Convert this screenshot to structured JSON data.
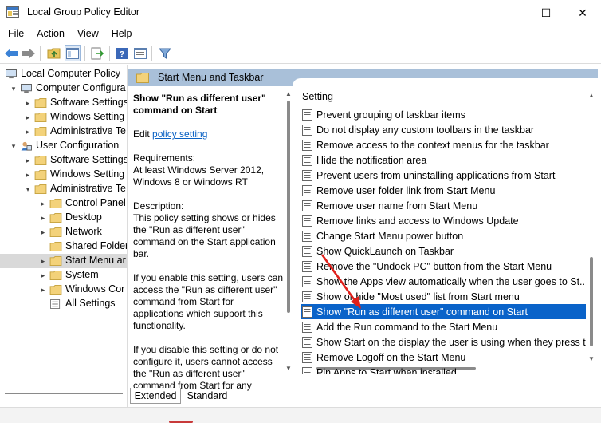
{
  "window": {
    "title": "Local Group Policy Editor",
    "minimize_glyph": "—",
    "maximize_glyph": "☐",
    "close_glyph": "✕"
  },
  "menubar": [
    "File",
    "Action",
    "View",
    "Help"
  ],
  "toolbar": {
    "icons": [
      "back-arrow-icon",
      "forward-arrow-icon",
      "up-folder-icon",
      "show-hide-tree-icon",
      "export-list-icon",
      "help-icon",
      "properties-icon",
      "filter-icon"
    ]
  },
  "tree": {
    "items": [
      {
        "label": "Local Computer Policy",
        "level": 0,
        "twisty": "",
        "icon": "computer-icon"
      },
      {
        "label": "Computer Configura",
        "level": 1,
        "twisty": "⌄",
        "icon": "computer-icon"
      },
      {
        "label": "Software Settings",
        "level": 2,
        "twisty": "›",
        "icon": "folder-icon"
      },
      {
        "label": "Windows Setting",
        "level": 2,
        "twisty": "›",
        "icon": "folder-icon"
      },
      {
        "label": "Administrative Te",
        "level": 2,
        "twisty": "›",
        "icon": "folder-icon"
      },
      {
        "label": "User Configuration",
        "level": 1,
        "twisty": "⌄",
        "icon": "user-icon"
      },
      {
        "label": "Software Settings",
        "level": 2,
        "twisty": "›",
        "icon": "folder-icon"
      },
      {
        "label": "Windows Setting",
        "level": 2,
        "twisty": "›",
        "icon": "folder-icon"
      },
      {
        "label": "Administrative Te",
        "level": 2,
        "twisty": "⌄",
        "icon": "folder-icon"
      },
      {
        "label": "Control Panel",
        "level": 3,
        "twisty": "›",
        "icon": "folder-icon"
      },
      {
        "label": "Desktop",
        "level": 3,
        "twisty": "›",
        "icon": "folder-icon"
      },
      {
        "label": "Network",
        "level": 3,
        "twisty": "›",
        "icon": "folder-icon"
      },
      {
        "label": "Shared Folder",
        "level": 3,
        "twisty": "",
        "icon": "folder-icon"
      },
      {
        "label": "Start Menu ar",
        "level": 3,
        "twisty": "›",
        "icon": "folder-icon",
        "selected": true
      },
      {
        "label": "System",
        "level": 3,
        "twisty": "›",
        "icon": "folder-icon"
      },
      {
        "label": "Windows Cor",
        "level": 3,
        "twisty": "›",
        "icon": "folder-icon"
      },
      {
        "label": "All Settings",
        "level": 3,
        "twisty": "",
        "icon": "settings-list-icon"
      }
    ]
  },
  "header": {
    "title": "Start Menu and Taskbar"
  },
  "description": {
    "title": "Show \"Run as different user\" command on Start",
    "edit_prefix": "Edit ",
    "edit_link": "policy setting ",
    "requirements": "Requirements:\nAt least Windows Server 2012, Windows 8 or Windows RT",
    "description": "Description:\nThis policy setting shows or hides the \"Run as different user\" command on the Start application bar.",
    "enable_text": "If you enable this setting, users can access the \"Run as different user\" command from Start for applications which support this functionality.",
    "disable_text": "If you disable this setting or do not configure it, users cannot access the \"Run as different user\" command from Start for any"
  },
  "settings_list": {
    "column_header": "Setting",
    "rows": [
      "Prevent grouping of taskbar items",
      "Do not display any custom toolbars in the taskbar",
      "Remove access to the context menus for the taskbar",
      "Hide the notification area",
      "Prevent users from uninstalling applications from Start",
      "Remove user folder link from Start Menu",
      "Remove user name from Start Menu",
      "Remove links and access to Windows Update",
      "Change Start Menu power button",
      "Show QuickLaunch on Taskbar",
      "Remove the \"Undock PC\" button from the Start Menu",
      "Show the Apps view automatically when the user goes to St...",
      "Show or hide \"Most used\" list from Start menu",
      "Show \"Run as different user\" command on Start",
      "Add the Run command to the Start Menu",
      "Show Start on the display the user is using when they press t...",
      "Remove Logoff on the Start Menu",
      "Pin Apps to Start when installed"
    ],
    "selected_index": 13
  },
  "tabs": [
    "Extended",
    "Standard"
  ],
  "active_tab": "Extended",
  "colors": {
    "header_band": "#a9c0d9",
    "selection": "#0a63c9",
    "link": "#0b62c4",
    "annotation_arrow": "#e0201b"
  }
}
